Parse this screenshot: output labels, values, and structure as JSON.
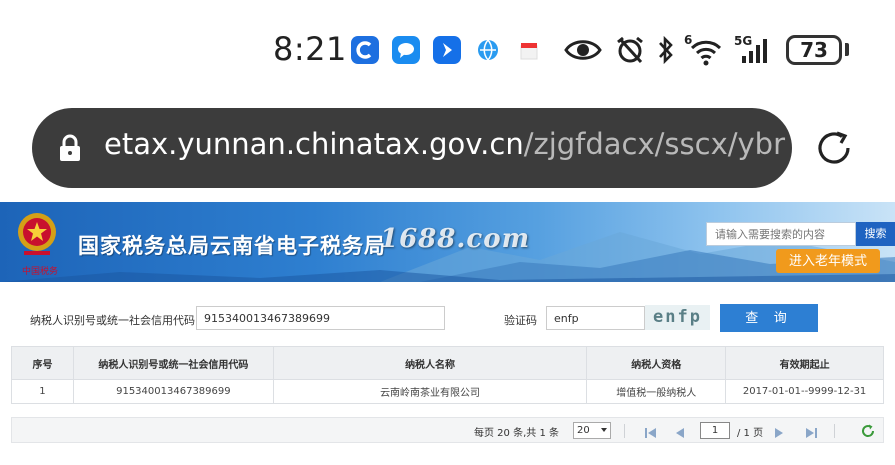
{
  "status_bar": {
    "time": "8:21",
    "network_label": "5G",
    "wifi_label": "6",
    "battery": "73",
    "icons": [
      "app-blue-c-icon",
      "message-icon",
      "arrow-app-icon",
      "globe-icon",
      "red-box-icon",
      "eye-icon",
      "alarm-off-icon",
      "bluetooth-icon",
      "wifi-icon",
      "signal-icon",
      "battery-icon"
    ]
  },
  "browser": {
    "url_host": "etax.yunnan.chinatax.gov.cn",
    "url_path": "/zjgfdacx/sscx/ybr",
    "icons": [
      "lock-icon",
      "reload-icon"
    ]
  },
  "banner": {
    "title": "国家税务总局云南省电子税务局",
    "emblem_caption": "中国税务",
    "watermark": "1688.com",
    "search_placeholder": "请输入需要搜索的内容",
    "search_button": "搜索",
    "elder_mode_button": "进入老年模式"
  },
  "form": {
    "taxpayer_id_label": "纳税人识别号或统一社会信用代码",
    "taxpayer_id_value": "915340013467389699",
    "captcha_label": "验证码",
    "captcha_value": "enfp",
    "captcha_image_text": "enfp",
    "query_button": "查 询"
  },
  "table": {
    "headers": [
      "序号",
      "纳税人识别号或统一社会信用代码",
      "纳税人名称",
      "纳税人资格",
      "有效期起止"
    ],
    "rows": [
      [
        "1",
        "915340013467389699",
        "云南岭南茶业有限公司",
        "增值税一般纳税人",
        "2017-01-01--9999-12-31"
      ]
    ]
  },
  "pagination": {
    "summary": "每页 20 条,共 1 条",
    "page_size": "20",
    "current_page": "1",
    "total_pages": "/ 1 页"
  },
  "colors": {
    "banner_blue": "#1d64b8",
    "query_button": "#2d7fd3",
    "elder_button": "#f19a1c",
    "search_button": "#1f63c1"
  }
}
